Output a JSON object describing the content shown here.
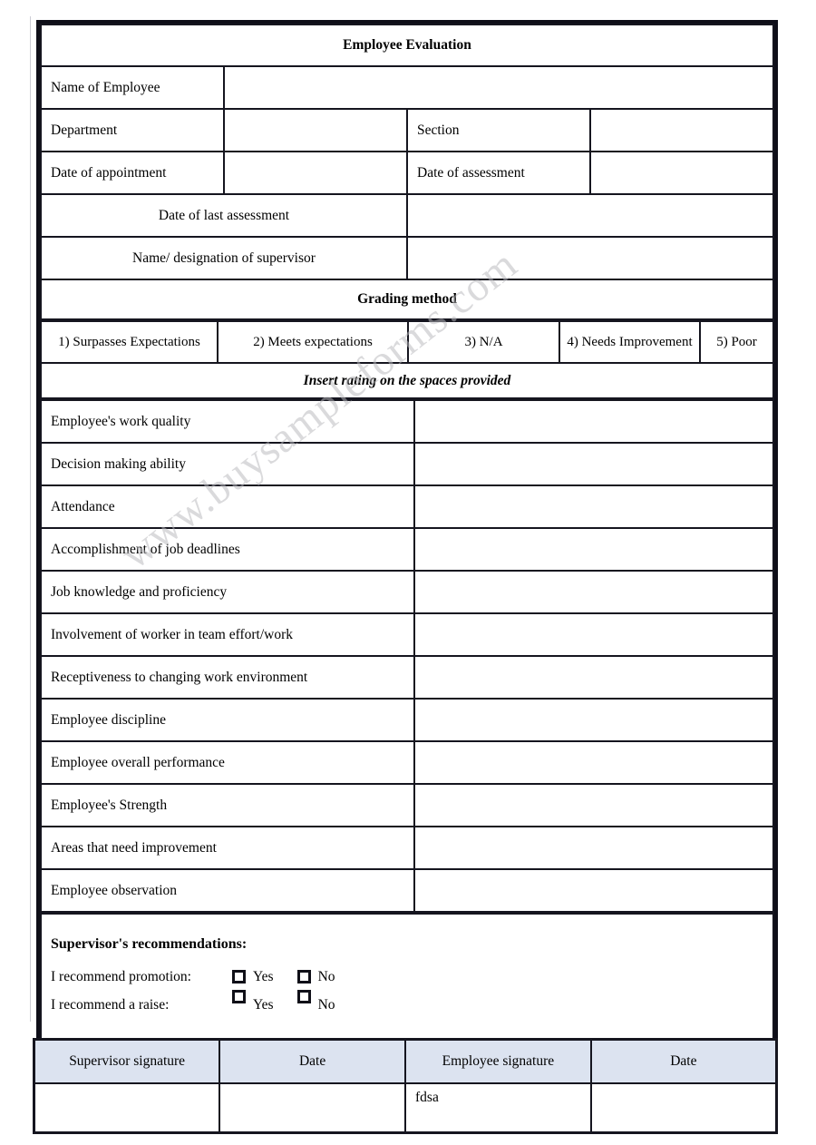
{
  "watermark": {
    "text": "www.buysampleforms.com"
  },
  "form": {
    "title": "Employee Evaluation",
    "fields": {
      "name_of_employee": "Name of Employee",
      "department": "Department",
      "section": "Section",
      "date_of_appointment": "Date of appointment",
      "date_of_assessment": "Date of assessment",
      "date_of_last_assessment": "Date of last assessment",
      "supervisor_name": "Name/ designation of supervisor"
    },
    "values": {
      "name_of_employee": "",
      "department": "",
      "section": "",
      "date_of_appointment": "",
      "date_of_assessment": "",
      "date_of_last_assessment": "",
      "supervisor_name": ""
    },
    "grading": {
      "heading": "Grading method",
      "scale": [
        "1) Surpasses Expectations",
        "2) Meets expectations",
        "3) N/A",
        "4) Needs Improvement",
        "5) Poor"
      ],
      "instruction": "Insert rating on the spaces provided"
    },
    "criteria": [
      {
        "label": "Employee's work quality",
        "rating": ""
      },
      {
        "label": "Decision making ability",
        "rating": ""
      },
      {
        "label": "Attendance",
        "rating": ""
      },
      {
        "label": "Accomplishment of job deadlines",
        "rating": ""
      },
      {
        "label": "Job knowledge and proficiency",
        "rating": ""
      },
      {
        "label": "Involvement of worker in team effort/work",
        "rating": ""
      },
      {
        "label": "Receptiveness to changing work environment",
        "rating": ""
      },
      {
        "label": "Employee discipline",
        "rating": ""
      },
      {
        "label": "Employee overall performance",
        "rating": ""
      },
      {
        "label": "Employee's Strength",
        "rating": ""
      },
      {
        "label": "Areas that need improvement",
        "rating": ""
      },
      {
        "label": "Employee observation",
        "rating": ""
      }
    ],
    "recommendations": {
      "title": "Supervisor's recommendations:",
      "promotion_label": "I recommend promotion:",
      "raise_label": "I recommend a raise:",
      "yes_label": "Yes",
      "no_label": "No"
    }
  },
  "signatures": {
    "headers": [
      "Supervisor signature",
      "Date",
      "Employee signature",
      "Date"
    ],
    "values": [
      "",
      "",
      "fdsa",
      ""
    ]
  },
  "colors": {
    "title_band": "#b6c7e0",
    "cell_shade": "#dce3f0",
    "border": "#15151f",
    "watermark": "#b9b9bd"
  }
}
